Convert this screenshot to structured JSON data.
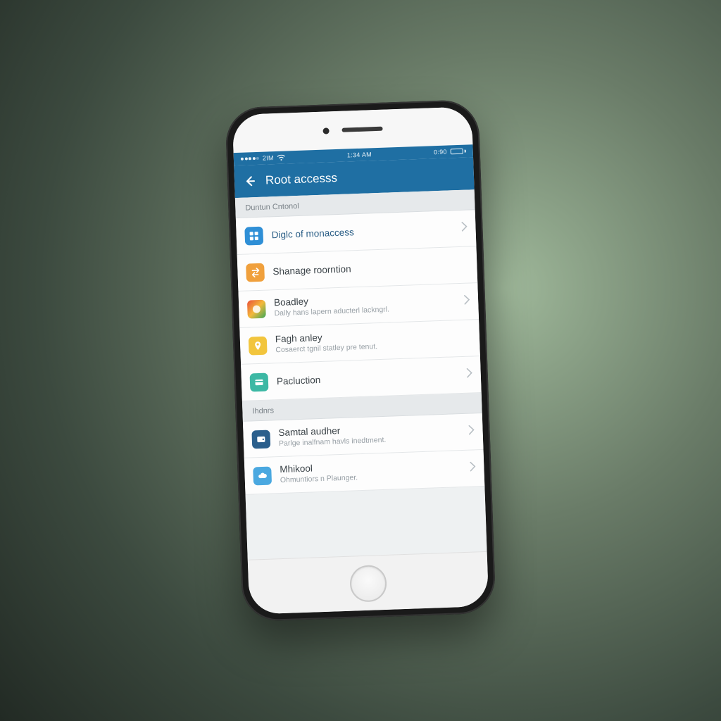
{
  "statusbar": {
    "carrier_dots": "•••••",
    "carrier_label": "2IM",
    "time": "1:34 AM",
    "battery_text": "0:90"
  },
  "header": {
    "title": "Root accesss"
  },
  "sections": [
    {
      "title": "Duntun Cntonol",
      "items": [
        {
          "icon": "grid-icon",
          "icon_class": "ic-blue",
          "label": "Diglc of monaccess",
          "sub": ""
        },
        {
          "icon": "swap-icon",
          "icon_class": "ic-orange",
          "label": "Shanage roorntion",
          "sub": ""
        },
        {
          "icon": "palette-icon",
          "icon_class": "ic-multi",
          "label": "Boadley",
          "sub": "Dally hans lapern aducterl lackngrl."
        },
        {
          "icon": "pin-icon",
          "icon_class": "ic-yellow",
          "label": "Fagh anley",
          "sub": "Cosaerct tgnil statley pre tenut."
        },
        {
          "icon": "card-icon",
          "icon_class": "ic-teal",
          "label": "Pacluction",
          "sub": ""
        }
      ]
    },
    {
      "title": "Ihdnrs",
      "items": [
        {
          "icon": "wallet-icon",
          "icon_class": "ic-navy",
          "label": "Samtal audher",
          "sub": "Parlge inalfnam havls inedtment."
        },
        {
          "icon": "cloud-icon",
          "icon_class": "ic-sky",
          "label": "Mhikool",
          "sub": "Ohmuntiors n Plaunger."
        }
      ]
    }
  ]
}
